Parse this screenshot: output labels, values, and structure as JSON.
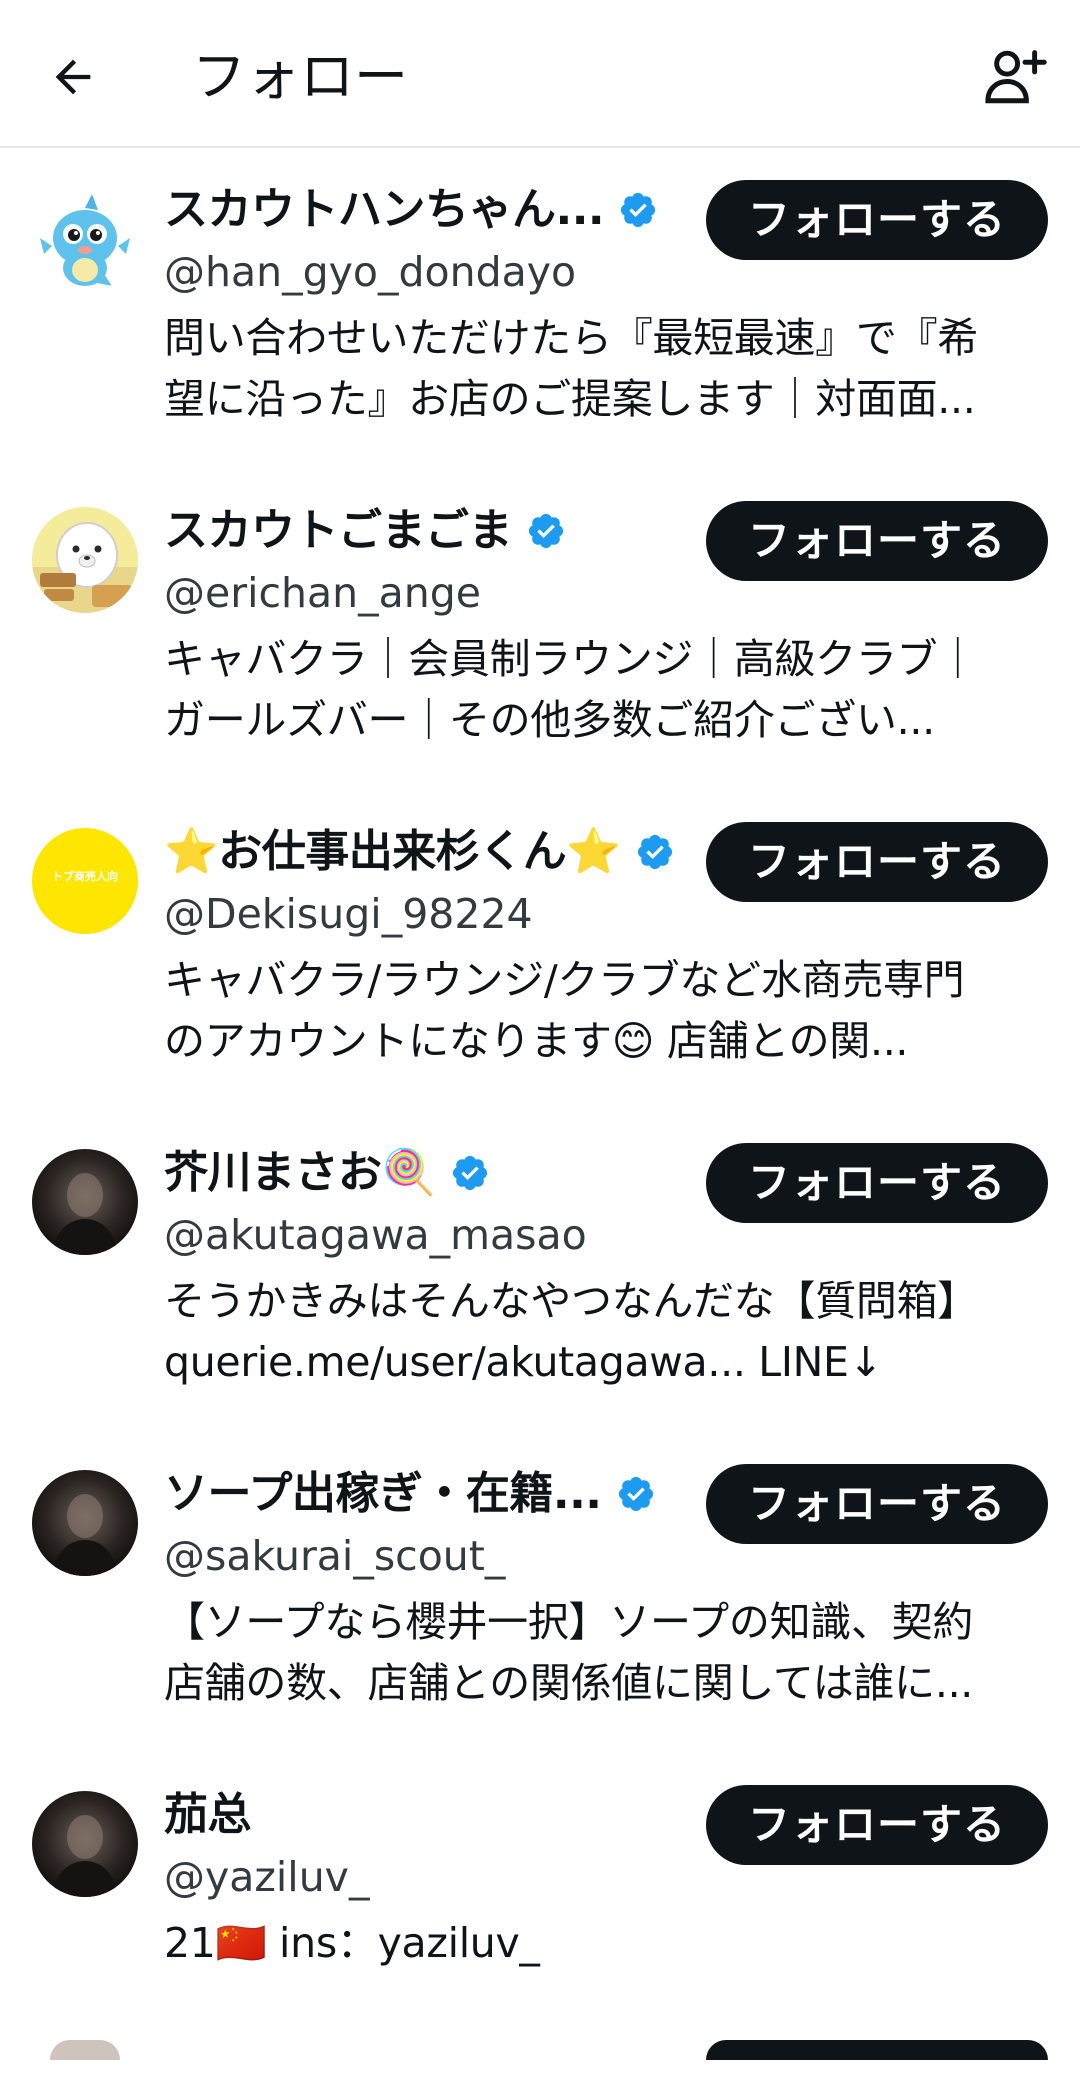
{
  "header": {
    "title": "フォロー"
  },
  "users": [
    {
      "name": "スカウトハンちゃん...",
      "verified": true,
      "handle": "@han_gyo_dondayo",
      "bio": [
        "問い合わせいただけたら『最短最速』で『希",
        "望に沿った』お店のご提案します｜対面面..."
      ],
      "follow_label": "フォローする",
      "avatar": "blue-fish-mascot"
    },
    {
      "name": "スカウトごまごま",
      "verified": true,
      "handle": "@erichan_ange",
      "bio": [
        "キャバクラ｜会員制ラウンジ｜高級クラブ｜",
        "ガールズバー｜その他多数ご紹介ござい..."
      ],
      "follow_label": "フォローする",
      "avatar": "seal-mascot"
    },
    {
      "name": "⭐お仕事出来杉くん⭐",
      "verified": true,
      "handle": "@Dekisugi_98224",
      "bio": [
        "キャバクラ/ラウンジ/クラブなど水商売専門",
        "のアカウントになります😊 店舗との関..."
      ],
      "follow_label": "フォローする",
      "avatar": "yellow-circle",
      "avatar_text": "トブ商売人向"
    },
    {
      "name": "芥川まさお🍭",
      "verified": true,
      "handle": "@akutagawa_masao",
      "bio": [
        "そうかきみはそんなやつなんだな【質問箱】",
        "querie.me/user/akutagawa... LINE↓"
      ],
      "follow_label": "フォローする",
      "avatar": "dark-photo"
    },
    {
      "name": "ソープ出稼ぎ・在籍...",
      "verified": true,
      "handle": "@sakurai_scout_",
      "bio": [
        "【ソープなら櫻井一択】ソープの知識、契約",
        "店舗の数、店舗との関係値に関しては誰に..."
      ],
      "follow_label": "フォローする",
      "avatar": "dark-photo"
    },
    {
      "name": "茄总",
      "verified": false,
      "handle": "@yaziluv_",
      "bio": [
        "21🇨🇳 ins：yaziluv_"
      ],
      "follow_label": "フォローする",
      "avatar": "dark-photo"
    }
  ],
  "colors": {
    "accent_verified": "#1d9bf0",
    "button_bg": "#0f1419",
    "button_text": "#ffffff",
    "text_primary": "#0f1419",
    "text_secondary": "#333b41"
  }
}
